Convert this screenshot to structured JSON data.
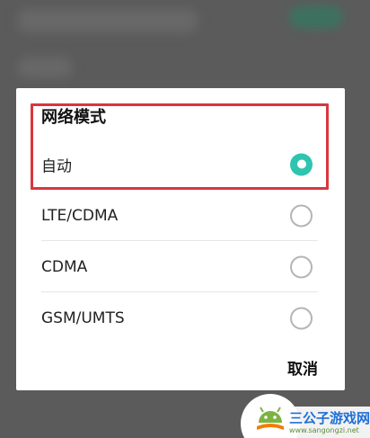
{
  "dialog": {
    "title": "网络模式",
    "options": [
      {
        "label": "自动",
        "selected": true
      },
      {
        "label": "LTE/CDMA",
        "selected": false
      },
      {
        "label": "CDMA",
        "selected": false
      },
      {
        "label": "GSM/UMTS",
        "selected": false
      }
    ],
    "cancel_label": "取消"
  },
  "colors": {
    "radio_selected": "#2ec4b0",
    "highlight_border": "#d9363e"
  },
  "watermark": {
    "title": "三公子游戏网",
    "url": "www.sangongzi.net"
  }
}
